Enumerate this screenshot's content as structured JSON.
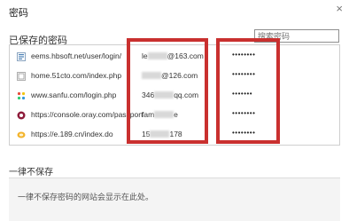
{
  "dialog": {
    "title": "密码",
    "close_glyph": "×"
  },
  "saved": {
    "heading": "已保存的密码",
    "search_placeholder": "搜索密码"
  },
  "passwords": [
    {
      "site": "eems.hbsoft.net/user/login/",
      "user_pre": "le",
      "user_post": "@163.com",
      "password": "••••••••",
      "icon": "hbsoft-favicon-icon",
      "color": "#4a7fb5"
    },
    {
      "site": "home.51cto.com/index.php",
      "user_pre": "",
      "user_post": "@126.com",
      "password": "••••••••",
      "icon": "51cto-favicon-icon",
      "color": "#c0392b"
    },
    {
      "site": "www.sanfu.com/login.php",
      "user_pre": "346",
      "user_post": "qq.com",
      "password": "•••••••",
      "icon": "sanfu-favicon-icon",
      "color": "#e67e22"
    },
    {
      "site": "https://console.oray.com/passport",
      "user_pre": "fam",
      "user_post": "e",
      "password": "••••••••",
      "icon": "oray-favicon-icon",
      "color": "#8e1b3a"
    },
    {
      "site": "https://e.189.cn/index.do",
      "user_pre": "15",
      "user_post": "178",
      "password": "••••••••",
      "icon": "189-favicon-icon",
      "color": "#e8a21c"
    }
  ],
  "never": {
    "heading": "一律不保存",
    "empty_text": "一律不保存密码的网站会显示在此处。"
  }
}
